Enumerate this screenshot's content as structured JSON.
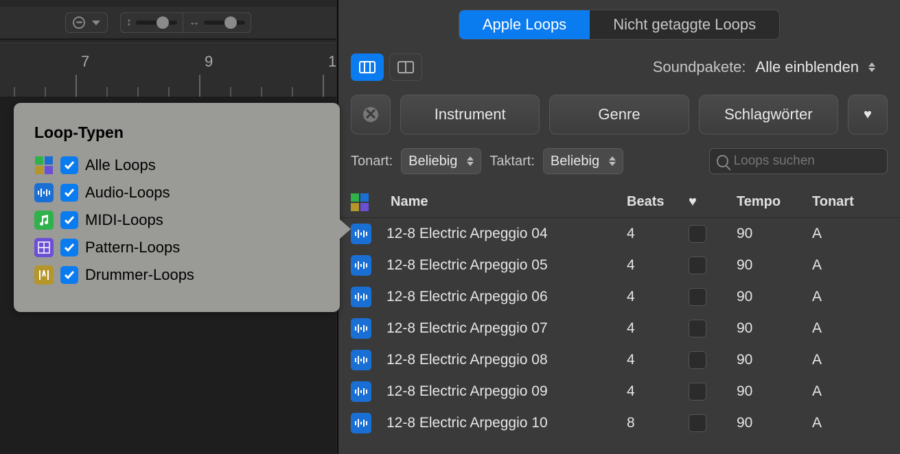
{
  "toolbar_left": {
    "ruler_marks": [
      "7",
      "9",
      "1"
    ]
  },
  "popover": {
    "title": "Loop-Typen",
    "items": [
      {
        "label": "Alle Loops",
        "icon": "all",
        "checked": true
      },
      {
        "label": "Audio-Loops",
        "icon": "audio",
        "checked": true
      },
      {
        "label": "MIDI-Loops",
        "icon": "midi",
        "checked": true
      },
      {
        "label": "Pattern-Loops",
        "icon": "pattern",
        "checked": true
      },
      {
        "label": "Drummer-Loops",
        "icon": "drummer",
        "checked": true
      }
    ]
  },
  "tabs": {
    "apple_loops": "Apple Loops",
    "untagged_loops": "Nicht getaggte Loops"
  },
  "soundpacks": {
    "label": "Soundpakete:",
    "value": "Alle einblenden"
  },
  "filters": {
    "instrument": "Instrument",
    "genre": "Genre",
    "keywords": "Schlagwörter"
  },
  "key_sig": {
    "tonart_label": "Tonart:",
    "tonart_value": "Beliebig",
    "taktart_label": "Taktart:",
    "taktart_value": "Beliebig"
  },
  "search": {
    "placeholder": "Loops suchen"
  },
  "table": {
    "headers": {
      "name": "Name",
      "beats": "Beats",
      "fav": "",
      "tempo": "Tempo",
      "tonart": "Tonart"
    },
    "rows": [
      {
        "name": "12-8 Electric Arpeggio 04",
        "beats": "4",
        "tempo": "90",
        "tonart": "A"
      },
      {
        "name": "12-8 Electric Arpeggio 05",
        "beats": "4",
        "tempo": "90",
        "tonart": "A"
      },
      {
        "name": "12-8 Electric Arpeggio 06",
        "beats": "4",
        "tempo": "90",
        "tonart": "A"
      },
      {
        "name": "12-8 Electric Arpeggio 07",
        "beats": "4",
        "tempo": "90",
        "tonart": "A"
      },
      {
        "name": "12-8 Electric Arpeggio 08",
        "beats": "4",
        "tempo": "90",
        "tonart": "A"
      },
      {
        "name": "12-8 Electric Arpeggio 09",
        "beats": "4",
        "tempo": "90",
        "tonart": "A"
      },
      {
        "name": "12-8 Electric Arpeggio 10",
        "beats": "8",
        "tempo": "90",
        "tonart": "A"
      }
    ]
  }
}
